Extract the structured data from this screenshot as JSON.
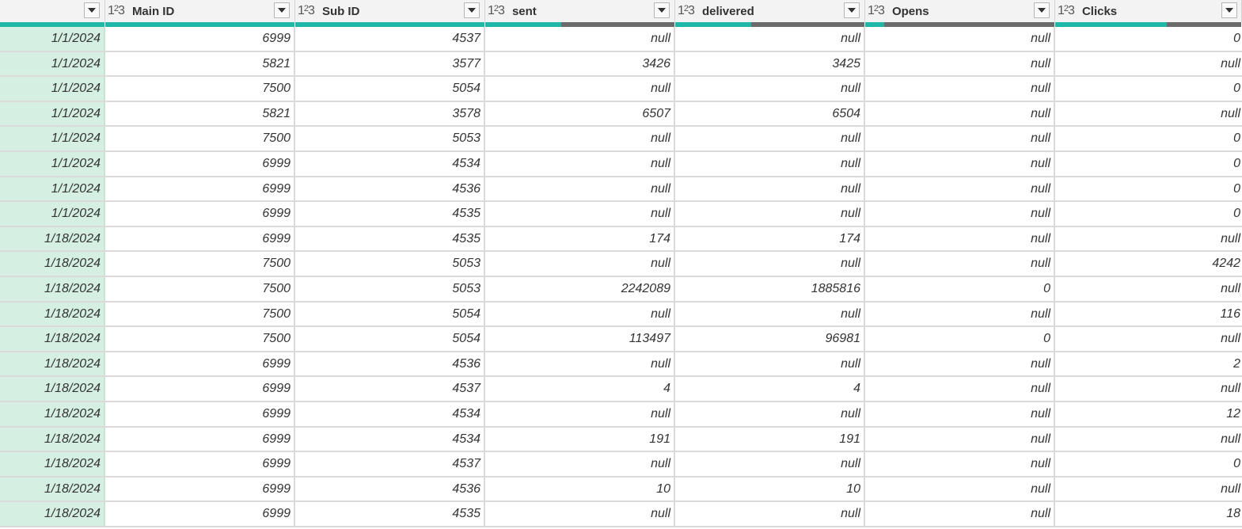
{
  "type_icon": {
    "pre": "1",
    "sup": "2",
    "post": "3"
  },
  "columns": [
    {
      "key": "date",
      "label": "",
      "typed": false,
      "valid_frac": 1.0
    },
    {
      "key": "main_id",
      "label": "Main ID",
      "typed": true,
      "valid_frac": 1.0
    },
    {
      "key": "sub_id",
      "label": "Sub ID",
      "typed": true,
      "valid_frac": 1.0
    },
    {
      "key": "sent",
      "label": "sent",
      "typed": true,
      "valid_frac": 0.4
    },
    {
      "key": "delivered",
      "label": "delivered",
      "typed": true,
      "valid_frac": 0.4
    },
    {
      "key": "opens",
      "label": "Opens",
      "typed": true,
      "valid_frac": 0.1
    },
    {
      "key": "clicks",
      "label": "Clicks",
      "typed": true,
      "valid_frac": 0.6
    }
  ],
  "rows": [
    [
      "1/1/2024",
      "6999",
      "4537",
      "null",
      "null",
      "null",
      "0"
    ],
    [
      "1/1/2024",
      "5821",
      "3577",
      "3426",
      "3425",
      "null",
      "null"
    ],
    [
      "1/1/2024",
      "7500",
      "5054",
      "null",
      "null",
      "null",
      "0"
    ],
    [
      "1/1/2024",
      "5821",
      "3578",
      "6507",
      "6504",
      "null",
      "null"
    ],
    [
      "1/1/2024",
      "7500",
      "5053",
      "null",
      "null",
      "null",
      "0"
    ],
    [
      "1/1/2024",
      "6999",
      "4534",
      "null",
      "null",
      "null",
      "0"
    ],
    [
      "1/1/2024",
      "6999",
      "4536",
      "null",
      "null",
      "null",
      "0"
    ],
    [
      "1/1/2024",
      "6999",
      "4535",
      "null",
      "null",
      "null",
      "0"
    ],
    [
      "1/18/2024",
      "6999",
      "4535",
      "174",
      "174",
      "null",
      "null"
    ],
    [
      "1/18/2024",
      "7500",
      "5053",
      "null",
      "null",
      "null",
      "4242"
    ],
    [
      "1/18/2024",
      "7500",
      "5053",
      "2242089",
      "1885816",
      "0",
      "null"
    ],
    [
      "1/18/2024",
      "7500",
      "5054",
      "null",
      "null",
      "null",
      "116"
    ],
    [
      "1/18/2024",
      "7500",
      "5054",
      "113497",
      "96981",
      "0",
      "null"
    ],
    [
      "1/18/2024",
      "6999",
      "4536",
      "null",
      "null",
      "null",
      "2"
    ],
    [
      "1/18/2024",
      "6999",
      "4537",
      "4",
      "4",
      "null",
      "null"
    ],
    [
      "1/18/2024",
      "6999",
      "4534",
      "null",
      "null",
      "null",
      "12"
    ],
    [
      "1/18/2024",
      "6999",
      "4534",
      "191",
      "191",
      "null",
      "null"
    ],
    [
      "1/18/2024",
      "6999",
      "4537",
      "null",
      "null",
      "null",
      "0"
    ],
    [
      "1/18/2024",
      "6999",
      "4536",
      "10",
      "10",
      "null",
      "null"
    ],
    [
      "1/18/2024",
      "6999",
      "4535",
      "null",
      "null",
      "null",
      "18"
    ]
  ],
  "colors": {
    "quality_valid": "#1fb7a6",
    "quality_empty": "#6b6b6b",
    "first_column_bg": "#d5efe2",
    "header_bg": "#f3f3f3"
  },
  "icons": {
    "filter": "chevron-down-icon",
    "type": "whole-number-type-icon"
  }
}
